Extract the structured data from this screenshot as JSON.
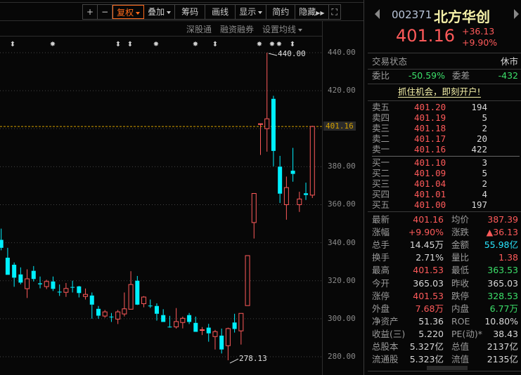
{
  "toolbar": {
    "zoom_in": "+",
    "zoom_out": "−",
    "adjust": "复权",
    "overlay": "叠加",
    "chips": "筹码",
    "draw": "画线",
    "display": "显示",
    "simple": "简约",
    "hide": "隐藏"
  },
  "subbar": {
    "sgt": "深股通",
    "margin": "融资融券",
    "ma": "设置均线"
  },
  "colors": {
    "up": "#ff5a5a",
    "down": "#00f0ff",
    "last_price_line": "#d4a000"
  },
  "axis": {
    "ticks": [
      "440.00",
      "420.00",
      "401.16",
      "380.00",
      "360.00",
      "340.00",
      "320.00",
      "300.00",
      "280.00"
    ]
  },
  "chart_data": {
    "type": "candlestick",
    "ylim": [
      276,
      446
    ],
    "last_price": 401.16,
    "high_label": "440.00",
    "low_label": "278.13",
    "candles": [
      [
        341.5,
        337.3,
        347.4,
        336.0
      ],
      [
        332.1,
        323.1,
        337.3,
        323.1
      ],
      [
        328.4,
        321.6,
        329.6,
        316.8
      ],
      [
        323.3,
        319.0,
        327.0,
        318.1
      ],
      [
        315.8,
        321.0,
        326.0,
        310.9
      ],
      [
        325.2,
        320.9,
        327.7,
        319.6
      ],
      [
        318.6,
        318.1,
        322.2,
        316.0
      ],
      [
        316.9,
        319.6,
        320.5,
        315.6
      ],
      [
        319.6,
        315.7,
        322.2,
        314.6
      ],
      [
        314.2,
        314.0,
        318.0,
        312.0
      ],
      [
        313.9,
        315.9,
        318.8,
        311.5
      ],
      [
        316.7,
        316.5,
        320.0,
        313.8
      ],
      [
        317.0,
        313.5,
        317.3,
        311.2
      ],
      [
        311.7,
        312.8,
        315.9,
        310.1
      ],
      [
        312.2,
        307.4,
        313.8,
        300.0
      ],
      [
        305.2,
        301.6,
        306.7,
        300.0
      ],
      [
        301.4,
        303.6,
        304.6,
        300.5
      ],
      [
        301.1,
        301.0,
        303.0,
        298.3
      ],
      [
        299.8,
        303.6,
        304.6,
        297.2
      ],
      [
        302.5,
        305.2,
        313.8,
        301.2
      ],
      [
        305.0,
        318.0,
        325.0,
        305.0
      ],
      [
        320.0,
        307.4,
        322.5,
        307.2
      ],
      [
        307.9,
        311.4,
        311.9,
        306.0
      ],
      [
        306.9,
        306.7,
        310.1,
        305.7
      ],
      [
        306.7,
        302.6,
        308.1,
        299.0
      ],
      [
        301.9,
        298.3,
        305.0,
        298.3
      ],
      [
        295.8,
        295.6,
        301.5,
        295.3
      ],
      [
        295.7,
        298.5,
        305.6,
        294.8
      ],
      [
        298.0,
        300.2,
        301.1,
        294.9
      ],
      [
        301.9,
        298.3,
        303.0,
        297.2
      ],
      [
        297.8,
        293.1,
        301.1,
        293.1
      ],
      [
        294.0,
        294.2,
        295.6,
        291.4
      ],
      [
        295.3,
        292.3,
        297.3,
        287.9
      ],
      [
        290.6,
        293.2,
        294.1,
        283.8
      ],
      [
        291.1,
        283.8,
        294.8,
        281.7
      ],
      [
        285.8,
        294.8,
        295.3,
        278.13
      ],
      [
        298.0,
        294.6,
        302.6,
        292.7
      ],
      [
        293.6,
        302.8,
        302.8,
        286.4
      ],
      [
        306.9,
        333.2,
        333.2,
        306.9
      ],
      [
        350.6,
        365.9,
        366.0,
        342.2
      ],
      [
        402.4,
        402.6,
        402.6,
        386.2
      ],
      [
        400.0,
        405.2,
        440.0,
        387.9
      ],
      [
        415.7,
        388.3,
        417.3,
        380.2
      ],
      [
        380.0,
        365.8,
        385.7,
        360.9
      ],
      [
        360.0,
        369.0,
        374.8,
        352.1
      ],
      [
        377.9,
        376.2,
        389.9,
        372.1
      ],
      [
        360.0,
        363.0,
        366.8,
        356.2
      ],
      [
        366.0,
        365.1,
        371.6,
        362.5
      ],
      [
        365.03,
        401.16,
        401.53,
        363.53
      ]
    ]
  },
  "stock": {
    "code": "002371",
    "name": "北方华创",
    "price": "401.16",
    "change": "+36.13",
    "pct": "+9.90%"
  },
  "status": {
    "label": "交易状态",
    "value": "休市"
  },
  "ratio": {
    "label1": "委比",
    "value1": "-50.59%",
    "label2": "委差",
    "value2": "-432"
  },
  "promo": "抓住机会，即刻开户!",
  "asks": [
    {
      "l": "卖五",
      "p": "401.20",
      "v": "194"
    },
    {
      "l": "卖四",
      "p": "401.19",
      "v": "5"
    },
    {
      "l": "卖三",
      "p": "401.18",
      "v": "2"
    },
    {
      "l": "卖二",
      "p": "401.17",
      "v": "20"
    },
    {
      "l": "卖一",
      "p": "401.16",
      "v": "422"
    }
  ],
  "bids": [
    {
      "l": "买一",
      "p": "401.10",
      "v": "3"
    },
    {
      "l": "买二",
      "p": "401.09",
      "v": "5"
    },
    {
      "l": "买三",
      "p": "401.04",
      "v": "2"
    },
    {
      "l": "买四",
      "p": "401.01",
      "v": "4"
    },
    {
      "l": "买五",
      "p": "401.00",
      "v": "197"
    }
  ],
  "stats": [
    {
      "l1": "最新",
      "v1": "401.16",
      "c1": "red",
      "l2": "均价",
      "v2": "387.39",
      "c2": "red"
    },
    {
      "l1": "涨幅",
      "v1": "+9.90%",
      "c1": "red",
      "l2": "涨跌",
      "v2": "▲36.13",
      "c2": "red"
    },
    {
      "l1": "总手",
      "v1": "14.45万",
      "c1": "wht",
      "l2": "金额",
      "v2": "55.98亿",
      "c2": "cyn"
    },
    {
      "l1": "换手",
      "v1": "2.71%",
      "c1": "wht",
      "l2": "量比",
      "v2": "1.38",
      "c2": "red"
    },
    {
      "l1": "最高",
      "v1": "401.53",
      "c1": "red",
      "l2": "最低",
      "v2": "363.53",
      "c2": "grn"
    },
    {
      "l1": "今开",
      "v1": "365.03",
      "c1": "wht",
      "l2": "昨收",
      "v2": "365.03",
      "c2": "wht"
    },
    {
      "l1": "涨停",
      "v1": "401.53",
      "c1": "red",
      "l2": "跌停",
      "v2": "328.53",
      "c2": "grn"
    },
    {
      "l1": "外盘",
      "v1": "7.68万",
      "c1": "red",
      "l2": "内盘",
      "v2": "6.77万",
      "c2": "grn"
    },
    {
      "l1": "净资产",
      "v1": "51.36",
      "c1": "wht",
      "l2": "ROE",
      "v2": "10.80%",
      "c2": "wht"
    },
    {
      "l1": "收益(三)",
      "v1": "5.220",
      "c1": "wht",
      "l2": "PE(动)*",
      "v2": "38.43",
      "c2": "wht"
    },
    {
      "l1": "总股本",
      "v1": "5.327亿",
      "c1": "wht",
      "l2": "总值",
      "v2": "2137亿",
      "c2": "wht"
    },
    {
      "l1": "流通股",
      "v1": "5.323亿",
      "c1": "wht",
      "l2": "流值",
      "v2": "2135亿",
      "c2": "wht"
    }
  ]
}
